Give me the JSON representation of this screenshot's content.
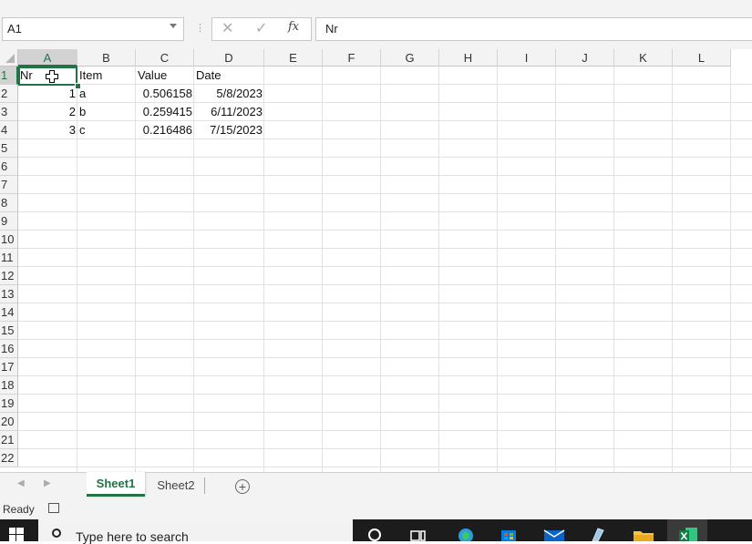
{
  "formula_bar": {
    "name_box": "A1",
    "formula_value": "Nr",
    "fx_label": "fx"
  },
  "sheet": {
    "columns": [
      "A",
      "B",
      "C",
      "D",
      "E",
      "F",
      "G",
      "H",
      "I",
      "J",
      "K",
      "L"
    ],
    "rows": [
      "1",
      "2",
      "3",
      "4",
      "5",
      "6",
      "7",
      "8",
      "9",
      "10",
      "11",
      "12",
      "13",
      "14",
      "15",
      "16",
      "17",
      "18",
      "19",
      "20",
      "21",
      "22"
    ],
    "active_cell": "A1",
    "cells": {
      "r1": [
        "Nr",
        "Item",
        "Value",
        "Date"
      ],
      "r2": [
        "1",
        "a",
        "0.506158",
        "5/8/2023"
      ],
      "r3": [
        "2",
        "b",
        "0.259415",
        "6/11/2023"
      ],
      "r4": [
        "3",
        "c",
        "0.216486",
        "7/15/2023"
      ]
    }
  },
  "tabs": {
    "sheet1": "Sheet1",
    "sheet2": "Sheet2",
    "add": "+"
  },
  "status": {
    "text": "Ready"
  },
  "taskbar": {
    "search_placeholder": "Type here to search"
  },
  "colors": {
    "accent": "#217346",
    "header_bg": "#f3f3f3",
    "taskbar_bg": "#1c1c1c"
  }
}
